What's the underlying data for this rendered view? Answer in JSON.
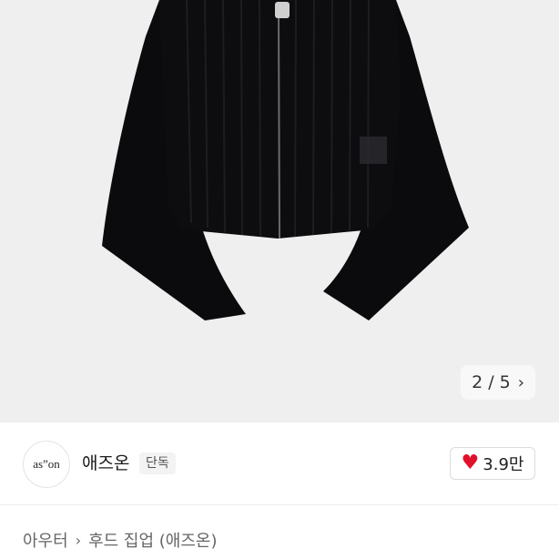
{
  "gallery": {
    "image_alt": "product-photo",
    "pager_current": "2",
    "pager_separator": "/",
    "pager_total": "5"
  },
  "brand": {
    "logo_text": "as”on",
    "name": "애즈온",
    "badge": "단독",
    "likes": "3.9만",
    "colors": {
      "heart": "#e0112b"
    }
  },
  "breadcrumb": {
    "items": [
      "아우터",
      "후드 집업 (애즈온)"
    ]
  }
}
